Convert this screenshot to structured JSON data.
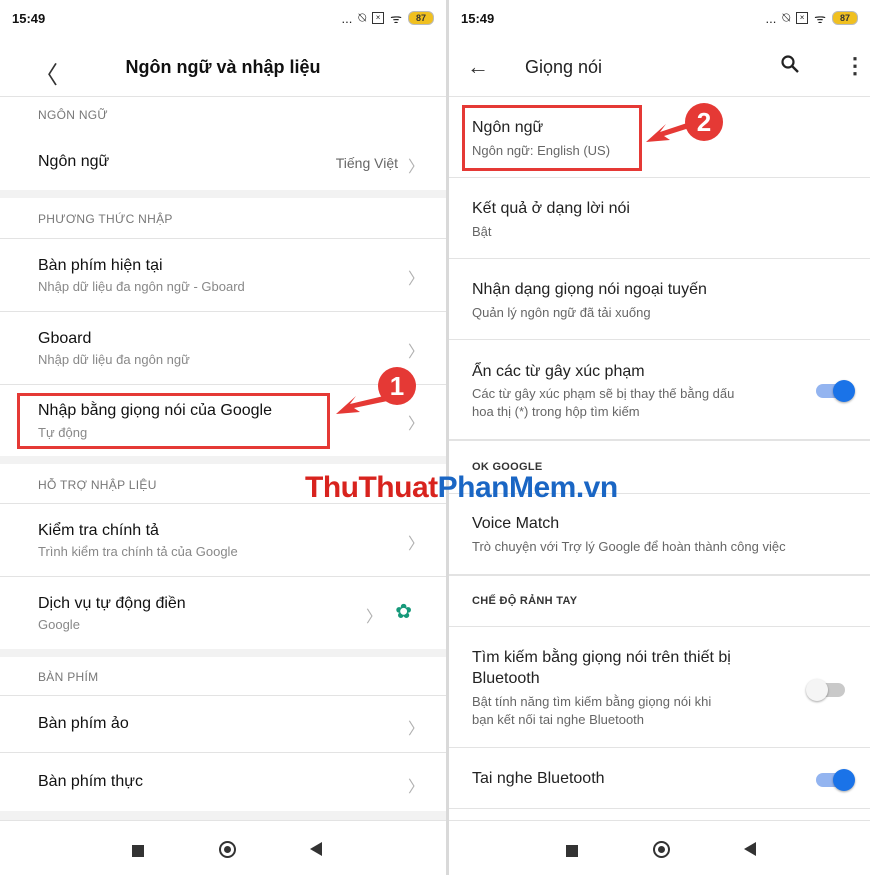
{
  "status": {
    "time": "15:49",
    "battery": "87",
    "dots": "...",
    "silent_glyph": "⍉",
    "box_glyph": "×",
    "wifi_glyph": "ᯤ"
  },
  "left": {
    "title": "Ngôn ngữ và nhập liệu",
    "back_glyph": "〈",
    "sections": {
      "language": "NGÔN NGỮ",
      "input_methods": "PHƯƠNG THỨC NHẬP",
      "input_assist": "HỖ TRỢ NHẬP LIỆU",
      "keyboard": "BÀN PHÍM"
    },
    "items": {
      "language": {
        "title": "Ngôn ngữ",
        "value": "Tiếng Việt"
      },
      "current_keyboard": {
        "title": "Bàn phím hiện tại",
        "sub": "Nhập dữ liệu đa ngôn ngữ - Gboard"
      },
      "gboard": {
        "title": "Gboard",
        "sub": "Nhập dữ liệu đa ngôn ngữ"
      },
      "google_voice": {
        "title": "Nhập bằng giọng nói của Google",
        "sub": "Tự động"
      },
      "spell_check": {
        "title": "Kiểm tra chính tả",
        "sub": "Trình kiểm tra chính tả của Google"
      },
      "autofill": {
        "title": "Dịch vụ tự động điền",
        "sub": "Google"
      },
      "virtual_keyboard": {
        "title": "Bàn phím ảo"
      },
      "physical_keyboard": {
        "title": "Bàn phím thực"
      }
    },
    "chevron": "〉",
    "gear_glyph": "✿",
    "badge": "1"
  },
  "right": {
    "title": "Giọng nói",
    "back_glyph": "←",
    "more_glyph": "⋮",
    "items": {
      "language": {
        "title": "Ngôn ngữ",
        "sub": "Ngôn ngữ: English (US)"
      },
      "speech_output": {
        "title": "Kết quả ở dạng lời nói",
        "sub": "Bật"
      },
      "offline": {
        "title": "Nhận dạng giọng nói ngoại tuyến",
        "sub": "Quản lý ngôn ngữ đã tải xuống"
      },
      "block_offensive": {
        "title": "Ẩn các từ gây xúc phạm",
        "sub1": "Các từ gây xúc phạm sẽ bị thay thế bằng dấu",
        "sub2": "hoa thị (*) trong hộp tìm kiếm",
        "toggle": true
      },
      "voice_match": {
        "title": "Voice Match",
        "sub": "Trò chuyện với Trợ lý Google để hoàn thành công việc"
      },
      "bt_search": {
        "title1": "Tìm kiếm bằng giọng nói trên thiết bị",
        "title2": "Bluetooth",
        "sub1": "Bật tính năng tìm kiếm bằng giọng nói khi",
        "sub2": "bạn kết nối tai nghe Bluetooth",
        "toggle": false
      },
      "bt_headset": {
        "title": "Tai nghe Bluetooth",
        "toggle": true
      }
    },
    "sections": {
      "ok_google": "OK GOOGLE",
      "hands_free": "CHẾ ĐỘ RẢNH TAY"
    },
    "badge": "2"
  },
  "watermark": {
    "part1": "ThuThuat",
    "part2": "PhanMem",
    "part3": ".vn"
  },
  "colors": {
    "accent_red": "#e53935",
    "toggle_blue": "#1a73e8",
    "gear_green": "#16997a"
  }
}
